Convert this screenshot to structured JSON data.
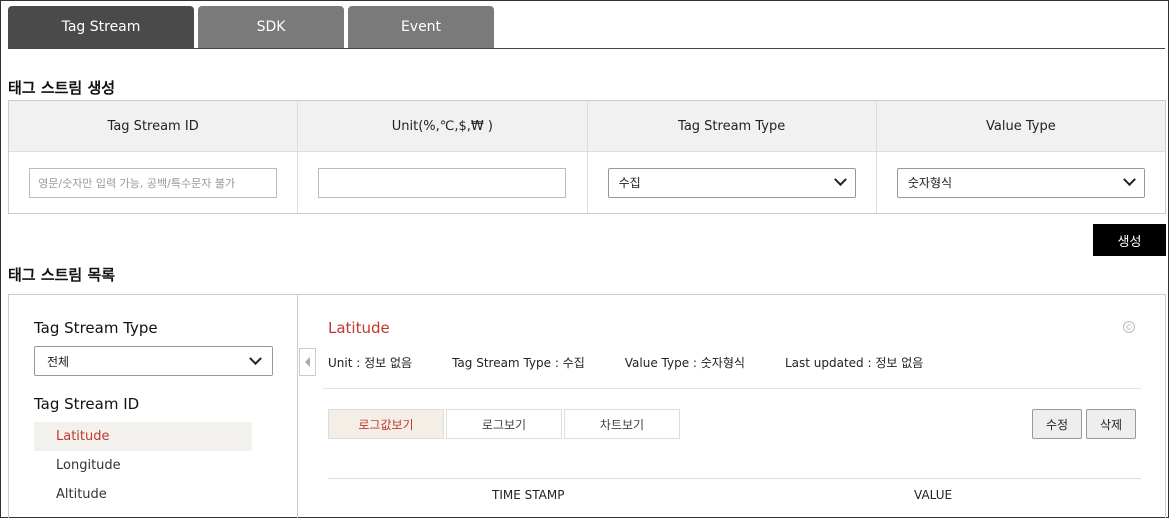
{
  "tabs": [
    {
      "label": "Tag Stream",
      "active": true
    },
    {
      "label": "SDK",
      "active": false
    },
    {
      "label": "Event",
      "active": false
    }
  ],
  "create_section": {
    "title": "태그 스트림 생성",
    "columns": [
      {
        "header": "Tag Stream ID",
        "placeholder": "영문/숫자만 입력 가능, 공백/특수문자 불가",
        "value": ""
      },
      {
        "header": "Unit(%,℃,$,₩ )",
        "value": ""
      },
      {
        "header": "Tag Stream Type",
        "selected": "수집"
      },
      {
        "header": "Value Type",
        "selected": "숫자형식"
      }
    ],
    "create_button": "생성"
  },
  "list_section": {
    "title": "태그 스트림 목록",
    "filter_label": "Tag Stream Type",
    "filter_selected": "전체",
    "id_label": "Tag Stream ID",
    "ids": [
      "Latitude",
      "Longitude",
      "Altitude"
    ],
    "selected_id": "Latitude"
  },
  "detail": {
    "title": "Latitude",
    "copy_icon": "©",
    "unit": "Unit : 정보 없음",
    "type": "Tag Stream Type : 수집",
    "value_type": "Value Type : 숫자형식",
    "last_updated": "Last updated : 정보 없음",
    "subtabs": [
      "로그값보기",
      "로그보기",
      "차트보기"
    ],
    "edit_button": "수정",
    "delete_button": "삭제",
    "table_headers": [
      "TIME STAMP",
      "VALUE"
    ]
  },
  "colors": {
    "accent": "#c0392b",
    "tab_active": "#4a4a4a",
    "tab_inactive": "#7a7a7a"
  }
}
